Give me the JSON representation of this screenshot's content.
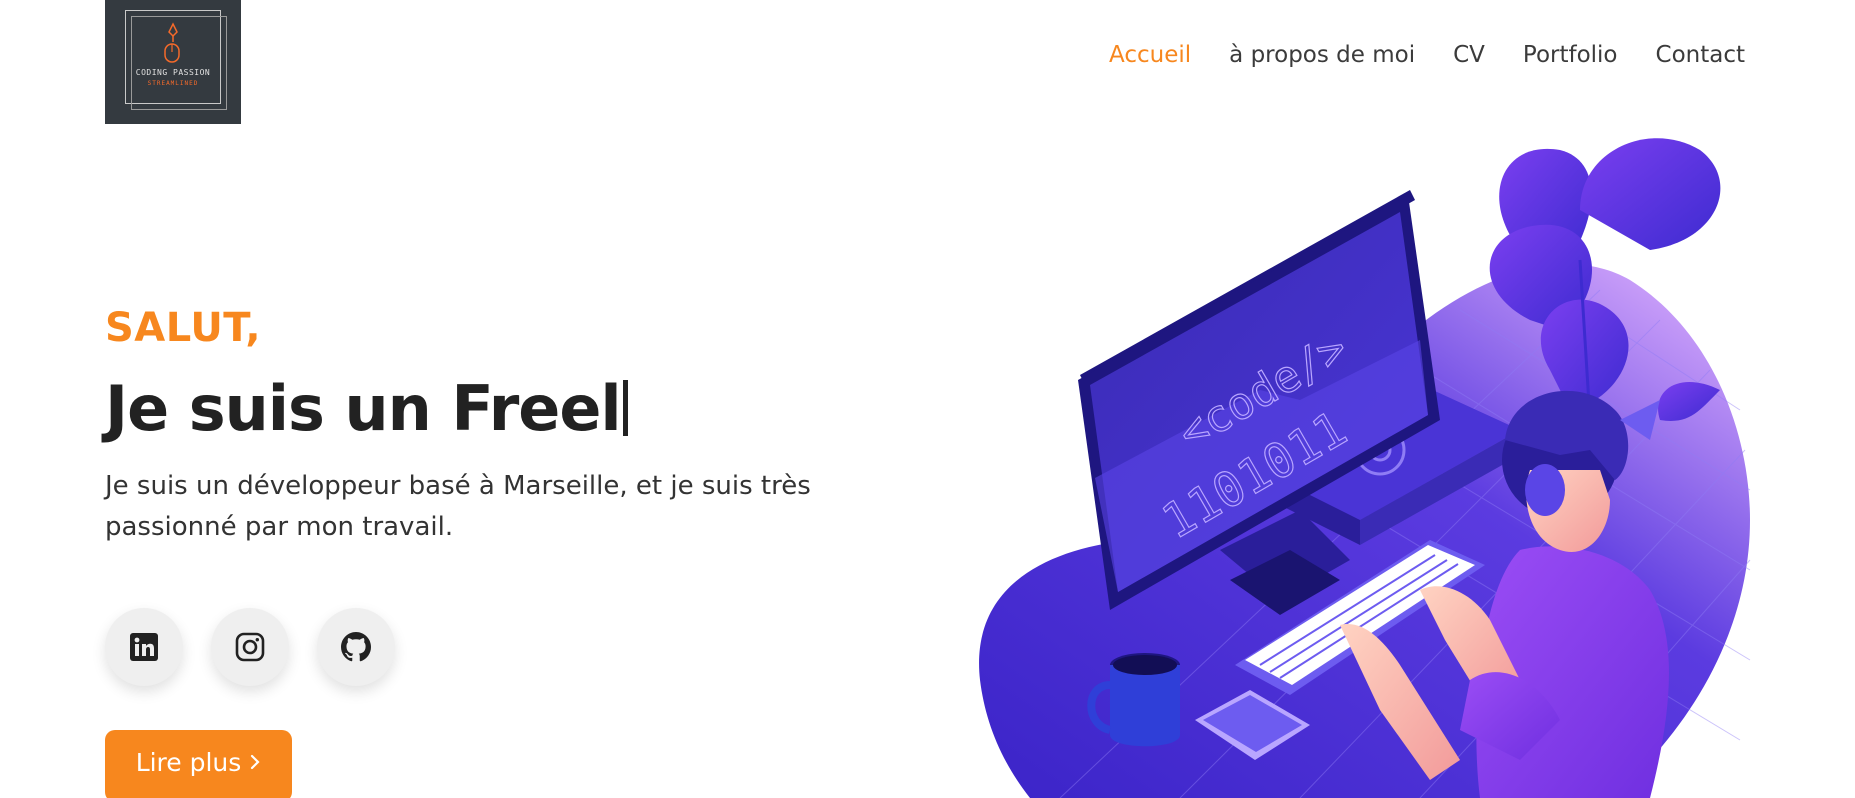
{
  "logo": {
    "line1": "CODING PASSION",
    "line2": "STREAMLINED"
  },
  "nav": {
    "items": [
      {
        "label": "Accueil",
        "active": true
      },
      {
        "label": "à propos de moi",
        "active": false
      },
      {
        "label": "CV",
        "active": false
      },
      {
        "label": "Portfolio",
        "active": false
      },
      {
        "label": "Contact",
        "active": false
      }
    ]
  },
  "hero": {
    "greeting": "SALUT,",
    "headline": "Je suis un Freel",
    "description": "Je suis un développeur basé à Marseille, et je suis très passionné par mon travail.",
    "cta_label": "Lire plus",
    "cta_icon": "chevron-right-icon"
  },
  "socials": [
    {
      "icon": "linkedin-icon"
    },
    {
      "icon": "instagram-icon"
    },
    {
      "icon": "github-icon"
    }
  ],
  "illustration": {
    "screen_text_1": "<code/>",
    "screen_text_2": "1101011"
  },
  "colors": {
    "accent": "#f7871e",
    "text": "#222222",
    "logo_bg": "#343a40",
    "illustration_primary": "#3b24c8",
    "illustration_secondary": "#8e4df0"
  }
}
